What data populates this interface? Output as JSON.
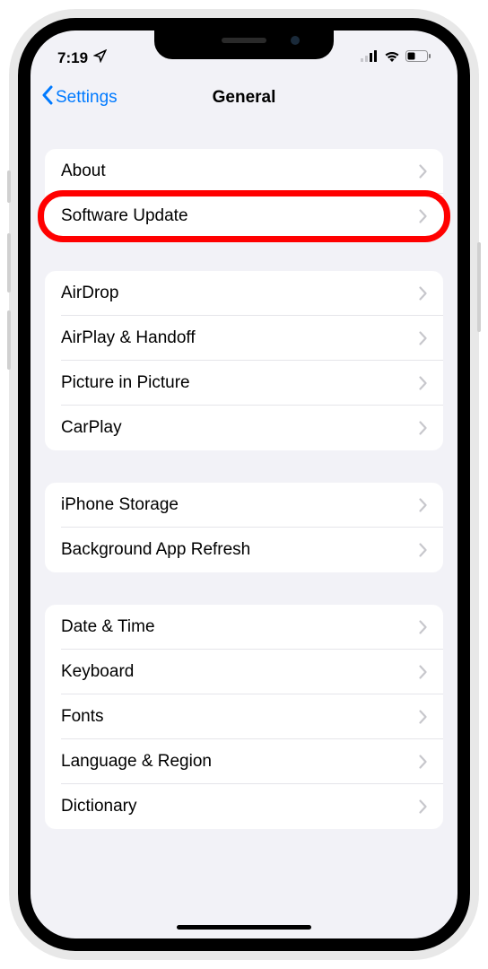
{
  "status": {
    "time": "7:19",
    "location_arrow": true
  },
  "nav": {
    "back_label": "Settings",
    "title": "General"
  },
  "groups": [
    {
      "items": [
        {
          "label": "About",
          "highlighted": false
        },
        {
          "label": "Software Update",
          "highlighted": true
        }
      ]
    },
    {
      "items": [
        {
          "label": "AirDrop",
          "highlighted": false
        },
        {
          "label": "AirPlay & Handoff",
          "highlighted": false
        },
        {
          "label": "Picture in Picture",
          "highlighted": false
        },
        {
          "label": "CarPlay",
          "highlighted": false
        }
      ]
    },
    {
      "items": [
        {
          "label": "iPhone Storage",
          "highlighted": false
        },
        {
          "label": "Background App Refresh",
          "highlighted": false
        }
      ]
    },
    {
      "items": [
        {
          "label": "Date & Time",
          "highlighted": false
        },
        {
          "label": "Keyboard",
          "highlighted": false
        },
        {
          "label": "Fonts",
          "highlighted": false
        },
        {
          "label": "Language & Region",
          "highlighted": false
        },
        {
          "label": "Dictionary",
          "highlighted": false
        }
      ]
    }
  ]
}
